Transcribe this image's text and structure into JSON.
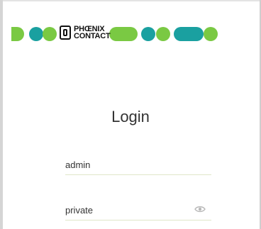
{
  "brand": {
    "name_line1": "PHŒNIX",
    "name_line2": "CONTACT",
    "colors": {
      "green": "#7ac943",
      "teal": "#1aa0a0",
      "black": "#111111"
    }
  },
  "login": {
    "title": "Login",
    "username": {
      "value": "admin"
    },
    "password": {
      "value": "private"
    }
  },
  "icons": {
    "show_password": "eye-icon"
  }
}
